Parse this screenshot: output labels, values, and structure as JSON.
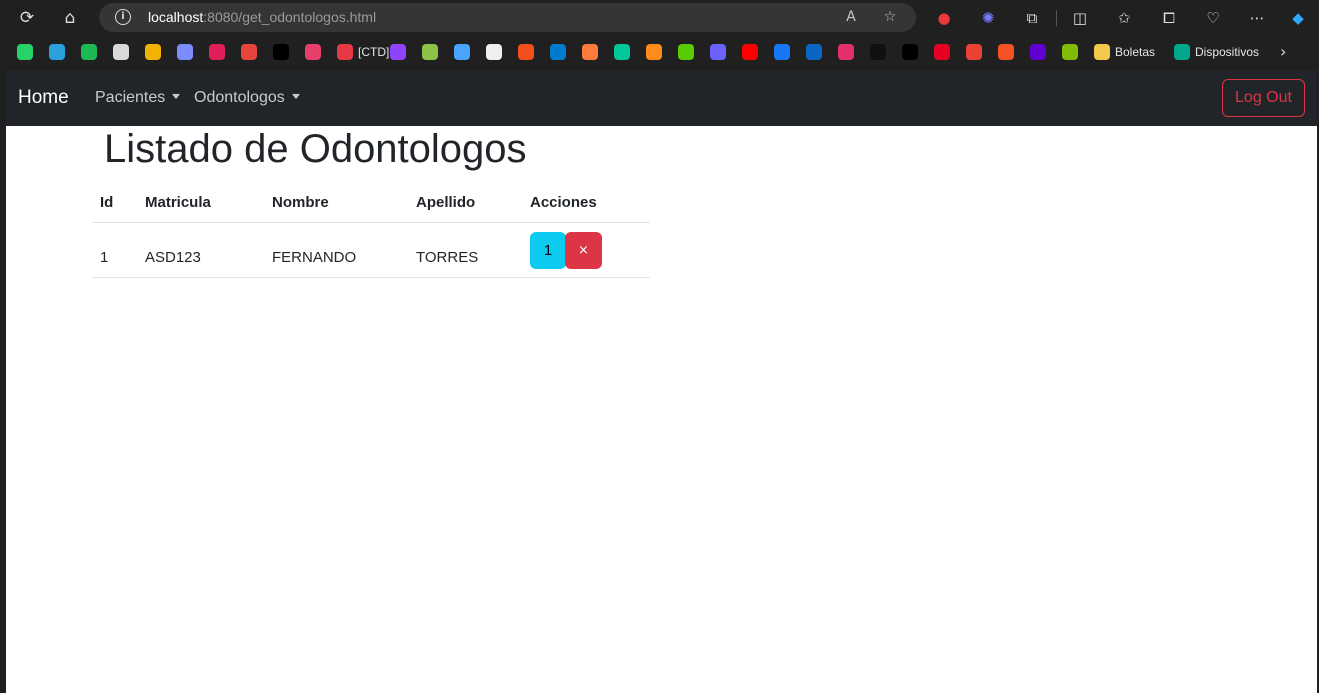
{
  "browser": {
    "url_host": "localhost",
    "url_path": ":8080/get_odontologos.html",
    "bookmarks": [
      {
        "name": "whatsapp",
        "color": "#25d366"
      },
      {
        "name": "telegram",
        "color": "#2aa1da"
      },
      {
        "name": "spotify",
        "color": "#1db954"
      },
      {
        "name": "chatgpt",
        "color": "#d9d9d9"
      },
      {
        "name": "miro",
        "color": "#f2b300"
      },
      {
        "name": "gemini",
        "color": "#7b8cff"
      },
      {
        "name": "slack",
        "color": "#e01e5a"
      },
      {
        "name": "1k",
        "color": "#e8453c"
      },
      {
        "name": "dev",
        "color": "#000000"
      },
      {
        "name": "bookmark-heart",
        "color": "#e83e6a"
      },
      {
        "label": "[CTD]",
        "name": "ctd",
        "color": "#e63946"
      },
      {
        "name": "udemy",
        "color": "#8e44ff"
      },
      {
        "name": "bookmark-green",
        "color": "#8bc34a"
      },
      {
        "name": "bookmark-blue",
        "color": "#4aa3ff"
      },
      {
        "name": "github",
        "color": "#f0f0f0"
      },
      {
        "name": "figma",
        "color": "#f24e1e"
      },
      {
        "name": "vscode",
        "color": "#007acc"
      },
      {
        "name": "bookmark-orange",
        "color": "#ff7a3d"
      },
      {
        "name": "bookmark-teal",
        "color": "#00c896"
      },
      {
        "name": "bookmark-r",
        "color": "#ff8c1a"
      },
      {
        "name": "duolingo",
        "color": "#58cc02"
      },
      {
        "name": "bookmark-s",
        "color": "#6c63ff"
      },
      {
        "name": "youtube",
        "color": "#ff0000"
      },
      {
        "name": "facebook",
        "color": "#1877f2"
      },
      {
        "name": "linkedin",
        "color": "#0a66c2"
      },
      {
        "name": "instagram",
        "color": "#e1306c"
      },
      {
        "name": "tiktok",
        "color": "#111111"
      },
      {
        "name": "x",
        "color": "#000000"
      },
      {
        "name": "pinterest",
        "color": "#e60023"
      },
      {
        "name": "gmail",
        "color": "#ea4335"
      },
      {
        "name": "microsoft",
        "color": "#f35325"
      },
      {
        "name": "yahoo-mail",
        "color": "#6001d2"
      },
      {
        "name": "microsoft-2",
        "color": "#81bc06"
      },
      {
        "label": "Boletas",
        "name": "folder",
        "color": "#f2c94c"
      },
      {
        "label": "Dispositivos",
        "name": "kaspersky",
        "color": "#00a88e"
      }
    ]
  },
  "navbar": {
    "brand": "Home",
    "menu": [
      {
        "label": "Pacientes"
      },
      {
        "label": "Odontologos"
      }
    ],
    "logout_label": "Log Out"
  },
  "page": {
    "title": "Listado de Odontologos",
    "table": {
      "columns": [
        "Id",
        "Matricula",
        "Nombre",
        "Apellido",
        "Acciones"
      ],
      "rows": [
        {
          "id": "1",
          "matricula": "ASD123",
          "nombre": "FERNANDO",
          "apellido": "TORRES",
          "edit_label": "1",
          "delete_label": "×"
        }
      ]
    }
  },
  "colors": {
    "navbar_bg": "#212529",
    "danger": "#dc3545",
    "info": "#0dcaf0"
  }
}
